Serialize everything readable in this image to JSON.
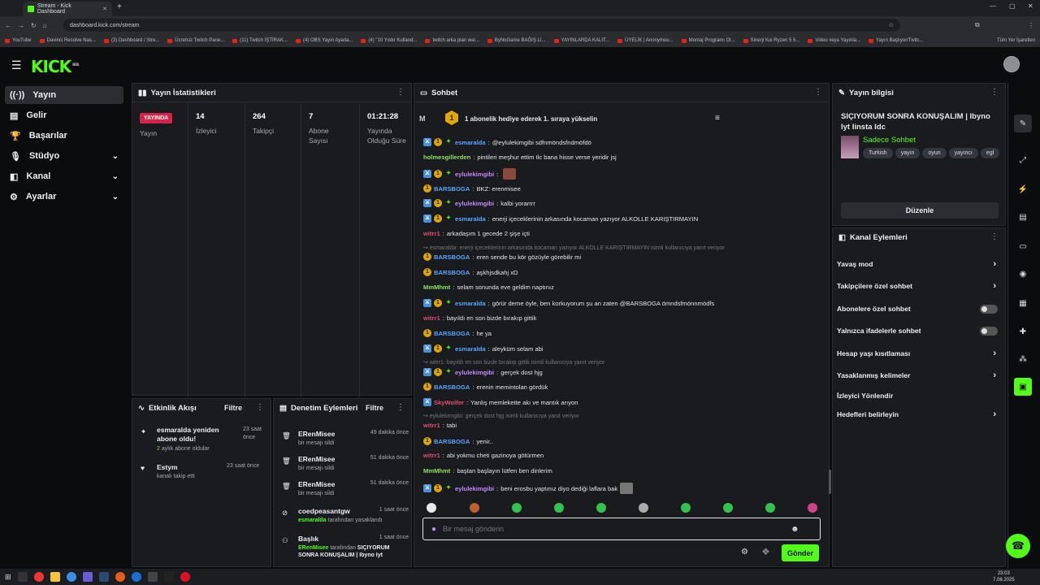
{
  "browser": {
    "tab_title": "Stream - Kick Dashboard",
    "url": "dashboard.kick.com/stream",
    "bookmarks": [
      "YouTube",
      "Davinci Resolve Nas...",
      "(3) Dashboard / Stre...",
      "Ücretsiz Twitch Pane...",
      "(11) Twitch İŞTİRAK...",
      "(4) OBS Yayın Ayarla...",
      "(4) \"10 Yıldır Kulland...",
      "twitch arka plan wal...",
      "ByNoGame BAĞIŞ Lİ...",
      "YAYINLARDA KALIT...",
      "ÜYELİK | Anonymou...",
      "Montaj Programı Ol...",
      "Sinerji Koi Ryzen 5 5...",
      "Video veya Yayınla...",
      "Yayın Başlıyor/Twitc..."
    ],
    "all_bookmarks": "Tüm Yer İşaretleri"
  },
  "app": {
    "logo": "KICK",
    "logo_badge": "BETA"
  },
  "nav": {
    "items": [
      {
        "label": "Yayın"
      },
      {
        "label": "Gelir"
      },
      {
        "label": "Başarılar"
      },
      {
        "label": "Stüdyo"
      },
      {
        "label": "Kanal"
      },
      {
        "label": "Ayarlar"
      }
    ]
  },
  "stats": {
    "title": "Yayın İstatistikleri",
    "live_badge": "YAYINDA",
    "live_label": "Yayın",
    "viewers_value": "14",
    "viewers_label": "İzleyici",
    "followers_value": "264",
    "followers_label": "Takipçi",
    "subs_value": "7",
    "subs_label": "Abone Sayısı",
    "duration_value": "01:21:28",
    "duration_label": "Yayında Olduğu Süre"
  },
  "activity": {
    "title": "Etkinlik Akışı",
    "filter": "Filtre",
    "items": [
      {
        "title": "esmaralda yeniden abone oldu!",
        "time": "23 saat önce",
        "sub_count": "2",
        "sub_text": "aylık abone oldular"
      },
      {
        "title": "Estym",
        "time": "23 saat önce",
        "sub_text": "kanalı takip etti"
      }
    ]
  },
  "moderation": {
    "title": "Denetim Eylemleri",
    "filter": "Filtre",
    "items": [
      {
        "user": "ERenMisee",
        "action": "bir mesajı sildi",
        "time": "49 dakika önce"
      },
      {
        "user": "ERenMisee",
        "action": "bir mesajı sildi",
        "time": "51 dakika önce"
      },
      {
        "user": "ERenMisee",
        "action": "bir mesajı sildi",
        "time": "51 dakika önce"
      },
      {
        "user": "coedpeasantgw",
        "action_user": "esmaralda",
        "action": "tarafından yasaklandı",
        "time": "1 saat önce"
      },
      {
        "user": "Başlık",
        "action_user": "ERenMisee",
        "action": "tarafından",
        "action_bold": "SIÇIYORUM SONRA KONUŞALIM | Ibyno Iyt",
        "time": "1 saat önce"
      }
    ]
  },
  "chat": {
    "title": "Sohbet",
    "pinned_avatar": "M",
    "pinned_rank": "1",
    "pinned_text": "1 abonelik hediye ederek 1. sıraya yükselin",
    "input_placeholder": "Bir mesaj gönderin",
    "send_label": "Gönder",
    "messages": [
      {
        "type": "msg",
        "badges": [
          "mod",
          "sub",
          "vip"
        ],
        "user": "esmaralda",
        "color": "#56a8ff",
        "text": "@eylulekimgibi sdfnmöndsfndmöfdö"
      },
      {
        "type": "msg",
        "badges": [],
        "user": "holmesgillerden",
        "color": "#8fe35b",
        "text": "pintileri meşhur ettim tlc bana hisse verse yeridir jsj"
      },
      {
        "type": "msg",
        "badges": [
          "mod",
          "sub",
          "vip"
        ],
        "user": "eylulekimgibi",
        "color": "#c58af9",
        "text": ""
      },
      {
        "type": "msg",
        "badges": [
          "sub"
        ],
        "user": "BARSBOGA",
        "color": "#56a8ff",
        "text": "BKZ: erenmisee"
      },
      {
        "type": "msg",
        "badges": [
          "mod",
          "sub",
          "vip"
        ],
        "user": "eylulekimgibi",
        "color": "#c58af9",
        "text": "kalbi yorarrrr"
      },
      {
        "type": "msg",
        "badges": [
          "mod",
          "sub",
          "vip"
        ],
        "user": "esmaralda",
        "color": "#56a8ff",
        "text": "enerji içeceklerinin arkasında kocaman yazıyor ALKOLLE KARIŞTIRMAYIN"
      },
      {
        "type": "msg",
        "badges": [],
        "user": "witrr1",
        "color": "#e2506d",
        "text": "arkadaşım 1 gecede 2 şişe içti"
      },
      {
        "type": "reply",
        "text": "esmaralda: enerji içeceklerinin arkasında kocaman yazıyor ALKOLLE KARIŞTIRMAYIN isimli kullanıcıya yanıt veriyor"
      },
      {
        "type": "msg",
        "badges": [
          "sub"
        ],
        "user": "BARSBOGA",
        "color": "#56a8ff",
        "text": "eren sende bu kör gözüyle görebilir mi"
      },
      {
        "type": "msg",
        "badges": [
          "sub"
        ],
        "user": "BARSBOGA",
        "color": "#56a8ff",
        "text": "aşkhjsdkahj xD"
      },
      {
        "type": "msg",
        "badges": [],
        "user": "MmMhmt",
        "color": "#8fe35b",
        "text": "selam sonunda eve geldim naptınız"
      },
      {
        "type": "msg",
        "badges": [
          "mod",
          "sub",
          "vip"
        ],
        "user": "esmaralda",
        "color": "#56a8ff",
        "text": "görür deme öyle, ben korkuyorum şu an zaten @BARSBOGA ömndsfmönnmödfs"
      },
      {
        "type": "msg",
        "badges": [],
        "user": "witrr1",
        "color": "#e2506d",
        "text": "bayıldı en son bizde bırakıp gittik"
      },
      {
        "type": "msg",
        "badges": [
          "sub"
        ],
        "user": "BARSBOGA",
        "color": "#56a8ff",
        "text": "he ya"
      },
      {
        "type": "msg",
        "badges": [
          "mod",
          "sub",
          "vip"
        ],
        "user": "esmaralda",
        "color": "#56a8ff",
        "text": "aleyküm selam abi"
      },
      {
        "type": "reply",
        "text": "witrr1: bayıldı en son bizde bırakıp gittik isimli kullanıcıya yanıt veriyor"
      },
      {
        "type": "msg",
        "badges": [
          "mod",
          "sub",
          "vip"
        ],
        "user": "eylulekimgibi",
        "color": "#c58af9",
        "text": "gerçek dost hjg"
      },
      {
        "type": "msg",
        "badges": [
          "sub"
        ],
        "user": "BARSBOGA",
        "color": "#56a8ff",
        "text": "erenin memintolan gördük"
      },
      {
        "type": "msg",
        "badges": [
          "mod"
        ],
        "user": "SkyWolfer",
        "color": "#e2506d",
        "text": "Yanlış memlekette akı ve mantık arıyon"
      },
      {
        "type": "reply",
        "text": "eylulekimgibi: gerçek dost hjg isimli kullanıcıya yanıt veriyor"
      },
      {
        "type": "msg",
        "badges": [],
        "user": "witrr1",
        "color": "#e2506d",
        "text": "tabi"
      },
      {
        "type": "msg",
        "badges": [
          "sub"
        ],
        "user": "BARSBOGA",
        "color": "#56a8ff",
        "text": "yenir.."
      },
      {
        "type": "msg",
        "badges": [],
        "user": "witrr1",
        "color": "#e2506d",
        "text": "abi yokmu cheti gazinoya götürmen"
      },
      {
        "type": "msg",
        "badges": [],
        "user": "MmMhmt",
        "color": "#8fe35b",
        "text": "baştan başlayın lütfen ben dinlerim"
      },
      {
        "type": "msg",
        "badges": [
          "mod",
          "sub",
          "vip"
        ],
        "user": "eylulekimgibi",
        "color": "#c58af9",
        "text": "beni erosbu yaptınız diyo dediği laflara bak"
      }
    ]
  },
  "stream_info": {
    "title": "Yayın bilgisi",
    "stream_title": "SIÇIYORUM SONRA KONUŞALIM | Ibyno Iyt Iinsta Idc",
    "category": "Sadece Sohbet",
    "tags": [
      "Turkish",
      "yayın",
      "oyun",
      "yayıncı",
      "egl"
    ],
    "edit_label": "Düzenle"
  },
  "channel_actions": {
    "title": "Kanal Eylemleri",
    "items": [
      {
        "label": "Yavaş mod",
        "kind": "chevron"
      },
      {
        "label": "Takipçilere özel sohbet",
        "kind": "chevron"
      },
      {
        "label": "Abonelere özel sohbet",
        "kind": "toggle"
      },
      {
        "label": "Yalnızca ifadelerle sohbet",
        "kind": "toggle"
      },
      {
        "label": "Hesap yaşı kısıtlaması",
        "kind": "chevron"
      },
      {
        "label": "Yasaklanmış kelimeler",
        "kind": "chevron"
      },
      {
        "label": "İzleyici Yönlendir",
        "kind": "none"
      },
      {
        "label": "Hedefleri belirleyin",
        "kind": "chevron"
      }
    ]
  },
  "taskbar": {
    "time": "23:03",
    "date": "7.08.2025"
  },
  "colors": {
    "brand": "#53fc18",
    "panel": "#191b1f",
    "live": "#d6234a"
  }
}
